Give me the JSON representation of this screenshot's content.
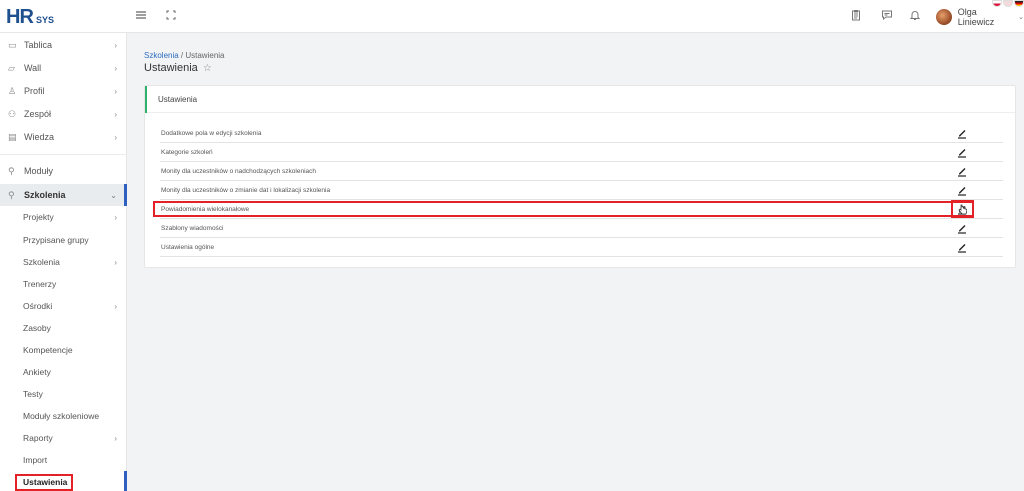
{
  "app": {
    "logo_main": "HR",
    "logo_sub": "SYS",
    "user_name": "Olga Liniewicz"
  },
  "colors": {
    "brand": "#1e4f8f",
    "accent": "#2f5fbf",
    "link": "#2c6cc0",
    "card_bar": "#2fb06a",
    "highlight": "#e32228"
  },
  "topbar": {
    "icons": [
      "menu-icon",
      "fullscreen-icon",
      "clipboard-icon",
      "chat-icon",
      "bell-icon"
    ]
  },
  "sidebar": {
    "items": [
      {
        "label": "Tablica",
        "icon": "monitor-icon",
        "chevron": "›"
      },
      {
        "label": "Wall",
        "icon": "wall-icon",
        "chevron": "›"
      },
      {
        "label": "Profil",
        "icon": "user-icon",
        "chevron": "›"
      },
      {
        "label": "Zespół",
        "icon": "team-icon",
        "chevron": "›"
      },
      {
        "label": "Wiedza",
        "icon": "book-icon",
        "chevron": "›"
      },
      {
        "label": "Moduły",
        "icon": "wrench-icon",
        "chevron": ""
      },
      {
        "label": "Szkolenia",
        "icon": "wrench-icon",
        "chevron": "⌄"
      }
    ],
    "sub_items": [
      {
        "label": "Projekty",
        "chevron": "›"
      },
      {
        "label": "Przypisane grupy",
        "chevron": ""
      },
      {
        "label": "Szkolenia",
        "chevron": "›"
      },
      {
        "label": "Trenerzy",
        "chevron": ""
      },
      {
        "label": "Ośrodki",
        "chevron": "›"
      },
      {
        "label": "Zasoby",
        "chevron": ""
      },
      {
        "label": "Kompetencje",
        "chevron": ""
      },
      {
        "label": "Ankiety",
        "chevron": ""
      },
      {
        "label": "Testy",
        "chevron": ""
      },
      {
        "label": "Moduły szkoleniowe",
        "chevron": ""
      },
      {
        "label": "Raporty",
        "chevron": "›"
      },
      {
        "label": "Import",
        "chevron": ""
      },
      {
        "label": "Ustawienia",
        "chevron": ""
      }
    ]
  },
  "breadcrumb": {
    "parent": "Szkolenia",
    "separator": " / ",
    "current": "Ustawienia"
  },
  "page": {
    "title": "Ustawienia",
    "star": "☆"
  },
  "card": {
    "title": "Ustawienia",
    "rows": [
      "Dodatkowe pola w edycji szkolenia",
      "Kategorie szkoleń",
      "Monity dla uczestników o nadchodzących szkoleniach",
      "Monity dla uczestników o zmianie dat i lokalizacji szkolenia",
      "Powiadomienia wielokanałowe",
      "Szablony wiadomości",
      "Ustawienia ogólne"
    ]
  }
}
